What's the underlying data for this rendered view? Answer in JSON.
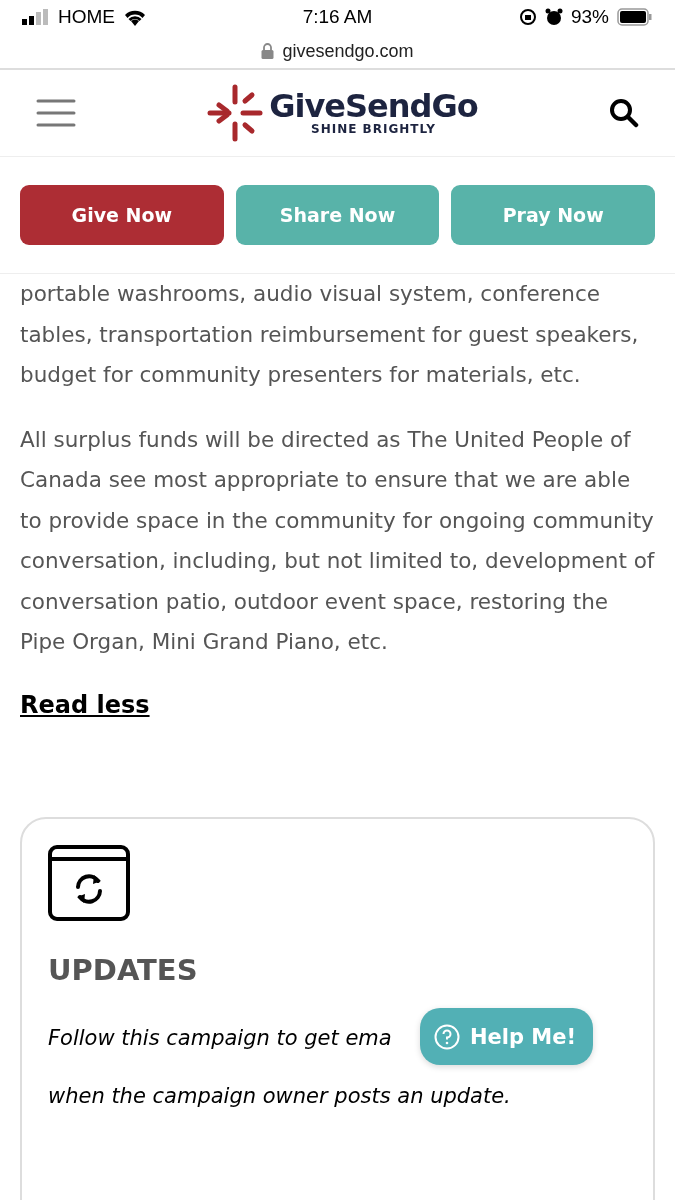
{
  "status_bar": {
    "carrier": "HOME",
    "time": "7:16 AM",
    "battery": "93%"
  },
  "address_bar": {
    "url": "givesendgo.com"
  },
  "header": {
    "logo_name": "GiveSendGo",
    "logo_tagline": "SHINE BRIGHTLY"
  },
  "action_buttons": [
    {
      "label": "Give Now",
      "kind": "primary"
    },
    {
      "label": "Share Now",
      "kind": "secondary"
    },
    {
      "label": "Pray Now",
      "kind": "secondary"
    }
  ],
  "paragraphs": [
    "portable washrooms, audio visual system, conference tables, transportation reimbursement for guest speakers, budget for community presenters for materials, etc.",
    "All surplus funds will be directed as The United People of Canada see most appropriate to ensure that we are able to provide space in the community for ongoing community conversation, including, but not limited to, development of conversation patio, outdoor event space, restoring the Pipe Organ, Mini Grand Piano, etc."
  ],
  "read_less": "Read less",
  "updates_card": {
    "title": "UPDATES",
    "description_lines": [
      "Follow this campaign to get ema",
      "when the campaign owner posts an update."
    ]
  },
  "help_button": {
    "label": "Help Me!"
  }
}
